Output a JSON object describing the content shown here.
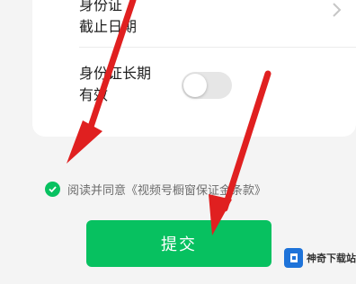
{
  "form": {
    "id_expiry_label_line1": "身份证",
    "id_expiry_label_line2": "截止日期",
    "id_longterm_label_line1": "身份证长期",
    "id_longterm_label_line2": "有效",
    "longterm_toggle_on": false
  },
  "agreement": {
    "text": "阅读并同意《视频号橱窗保证金条款》",
    "checked": true
  },
  "submit": {
    "label": "提交"
  },
  "watermark": {
    "text": "神奇下载站"
  },
  "colors": {
    "primary": "#07c160",
    "annotation_arrow": "#e02020"
  },
  "icons": [
    "chevron-right-icon",
    "check-icon",
    "red-arrow-annotation"
  ]
}
